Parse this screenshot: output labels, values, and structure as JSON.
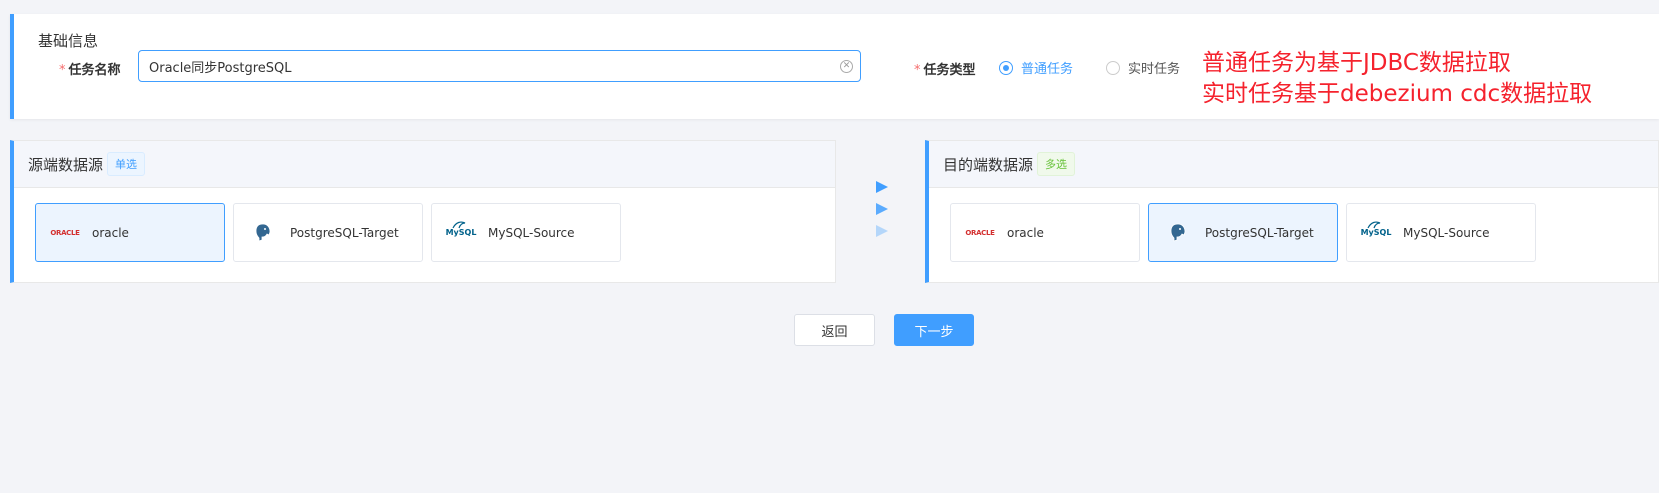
{
  "basic_info": {
    "title": "基础信息",
    "task_name_label": "任务名称",
    "task_name_value": "Oracle同步PostgreSQL",
    "task_type_label": "任务类型",
    "required_mark": "*",
    "task_type_options": [
      "普通任务",
      "实时任务"
    ],
    "task_type_selected": "普通任务",
    "annotation": "普通任务为基于JDBC数据拉取\n实时任务基于debezium cdc数据拉取"
  },
  "source": {
    "title": "源端数据源",
    "badge": "单选",
    "items": [
      {
        "name": "oracle",
        "logo": "ORACLE",
        "selected": true
      },
      {
        "name": "PostgreSQL-Target",
        "logo": "postgresql-elephant-icon",
        "selected": false
      },
      {
        "name": "MySQL-Source",
        "logo": "MySQL",
        "selected": false
      }
    ]
  },
  "target": {
    "title": "目的端数据源",
    "badge": "多选",
    "items": [
      {
        "name": "oracle",
        "logo": "ORACLE",
        "selected": false
      },
      {
        "name": "PostgreSQL-Target",
        "logo": "postgresql-elephant-icon",
        "selected": true
      },
      {
        "name": "MySQL-Source",
        "logo": "MySQL",
        "selected": false
      }
    ]
  },
  "buttons": {
    "back": "返回",
    "next": "下一步"
  },
  "colors": {
    "primary": "#409eff",
    "annotation": "#f5222d",
    "multi_badge": "#67c23a"
  }
}
